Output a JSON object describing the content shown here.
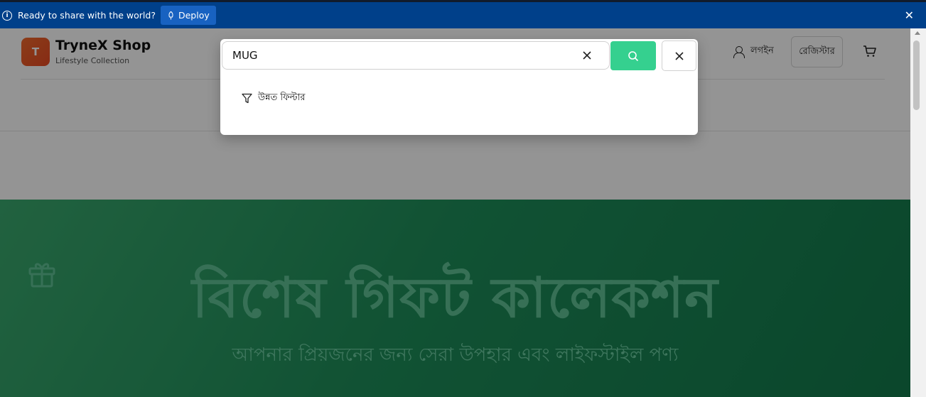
{
  "banner": {
    "message": "Ready to share with the world?",
    "deploy_label": "Deploy",
    "close_glyph": "✕"
  },
  "header": {
    "logo_letter": "T",
    "brand_name": "TryneX Shop",
    "brand_sub": "Lifestyle Collection",
    "login_label": "লগইন",
    "register_label": "রেজিস্টার"
  },
  "hero": {
    "title": "বিশেষ গিফট কালেকশন",
    "subtitle": "আপনার প্রিয়জনের জন্য সেরা উপহার এবং লাইফস্টাইল পণ্য"
  },
  "search": {
    "value": "MUG",
    "advanced_filter_label": "উন্নত ফিল্টার"
  },
  "colors": {
    "banner_bg": "#00408a",
    "search_button": "#35d08f",
    "hero_green": "#1e8e5a",
    "logo_orange": "#e84a23"
  },
  "icons": [
    "info-icon",
    "rocket-icon",
    "close-icon",
    "user-icon",
    "cart-icon",
    "gift-icon",
    "search-icon",
    "filter-icon"
  ]
}
